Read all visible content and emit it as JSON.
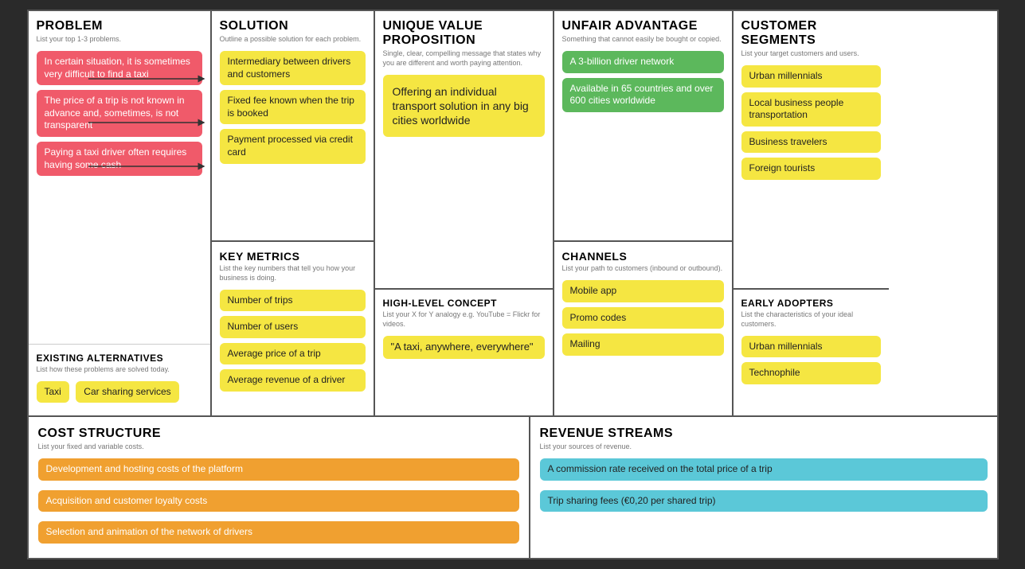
{
  "problem": {
    "title": "PROBLEM",
    "subtitle": "List your top 1-3 problems.",
    "tags": [
      "In certain situation, it is sometimes very difficult to find a taxi",
      "The price of a trip is not known in advance and, sometimes, is not transparent",
      "Paying a taxi driver often requires having some cash"
    ],
    "existing_title": "EXISTING ALTERNATIVES",
    "existing_subtitle": "List how these problems are solved today.",
    "existing_tags": [
      "Taxi",
      "Car sharing services"
    ]
  },
  "solution": {
    "title": "SOLUTION",
    "subtitle": "Outline a possible solution for each problem.",
    "tags": [
      "Intermediary between drivers and customers",
      "Fixed fee known when the trip is booked",
      "Payment processed via credit card"
    ],
    "metrics_title": "KEY METRICS",
    "metrics_subtitle": "List the key numbers that tell you how your business is doing.",
    "metrics_tags": [
      "Number of trips",
      "Number of users",
      "Average price of a trip",
      "Average revenue of a driver"
    ]
  },
  "uvp": {
    "title": "UNIQUE VALUE PROPOSITION",
    "subtitle": "Single, clear, compelling message that states why you are different and worth paying attention.",
    "tag": "Offering an individual transport solution in any big cities worldwide",
    "concept_title": "HIGH-LEVEL CONCEPT",
    "concept_subtitle": "List your X for Y analogy e.g. YouTube = Flickr for videos.",
    "concept_tag": "\"A taxi, anywhere, everywhere\""
  },
  "unfair": {
    "title": "UNFAIR ADVANTAGE",
    "subtitle": "Something that cannot easily be bought or copied.",
    "tags_green": [
      "A 3-billion driver network",
      "Available in 65 countries and over 600 cities worldwide"
    ],
    "channels_title": "CHANNELS",
    "channels_subtitle": "List your path to customers (inbound or outbound).",
    "channels_tags": [
      "Mobile app",
      "Promo codes",
      "Mailing"
    ]
  },
  "customer": {
    "title": "CUSTOMER SEGMENTS",
    "subtitle": "List your target customers and users.",
    "tags": [
      "Urban millennials",
      "Local business people transportation",
      "Business travelers",
      "Foreign tourists"
    ],
    "early_title": "EARLY ADOPTERS",
    "early_subtitle": "List the characteristics of your ideal customers.",
    "early_tags": [
      "Urban millennials",
      "Technophile"
    ]
  },
  "cost": {
    "title": "COST STRUCTURE",
    "subtitle": "List your fixed and variable costs.",
    "tags": [
      "Development and hosting costs of the platform",
      "Acquisition and customer loyalty costs",
      "Selection and animation of the network of drivers"
    ]
  },
  "revenue": {
    "title": "REVENUE STREAMS",
    "subtitle": "List your sources of revenue.",
    "tags": [
      "A commission rate received on the total price of a trip",
      "Trip sharing fees (€0,20 per shared trip)"
    ]
  }
}
